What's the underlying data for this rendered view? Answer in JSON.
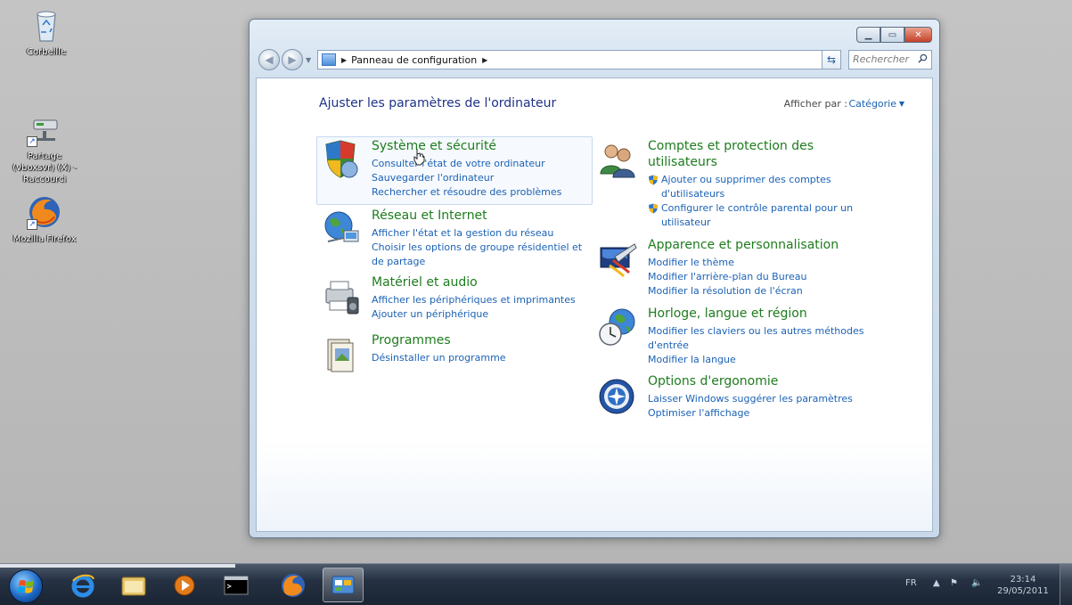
{
  "desktop": {
    "icons": [
      {
        "label": "Corbeille"
      },
      {
        "label": "Partage (vboxsvr) (X) - Raccourci"
      },
      {
        "label": "Mozilla Firefox"
      }
    ]
  },
  "window": {
    "address": {
      "crumb": "Panneau de configuration"
    },
    "search": {
      "placeholder": "Rechercher"
    },
    "page_title": "Ajuster les paramètres de l'ordinateur",
    "view_by": {
      "label": "Afficher par :",
      "value": "Catégorie"
    },
    "left_categories": [
      {
        "title": "Système et sécurité",
        "icon": "shield-security-icon",
        "links": [
          "Consulter l'état de votre ordinateur",
          "Sauvegarder l'ordinateur",
          "Rechercher et résoudre des problèmes"
        ]
      },
      {
        "title": "Réseau et Internet",
        "icon": "network-globe-icon",
        "links": [
          "Afficher l'état et la gestion du réseau",
          "Choisir les options de groupe résidentiel et de partage"
        ]
      },
      {
        "title": "Matériel et audio",
        "icon": "printer-speaker-icon",
        "links": [
          "Afficher les périphériques et imprimantes",
          "Ajouter un périphérique"
        ]
      },
      {
        "title": "Programmes",
        "icon": "programs-box-icon",
        "links": [
          "Désinstaller un programme"
        ]
      }
    ],
    "right_categories": [
      {
        "title": "Comptes et protection des utilisateurs",
        "icon": "users-icon",
        "links": [
          "Ajouter ou supprimer des comptes d'utilisateurs",
          "Configurer le contrôle parental pour un utilisateur"
        ]
      },
      {
        "title": "Apparence et personnalisation",
        "icon": "appearance-icon",
        "links": [
          "Modifier le thème",
          "Modifier l'arrière-plan du Bureau",
          "Modifier la résolution de l'écran"
        ]
      },
      {
        "title": "Horloge, langue et région",
        "icon": "clock-globe-icon",
        "links": [
          "Modifier les claviers ou les autres méthodes d'entrée",
          "Modifier la langue"
        ]
      },
      {
        "title": "Options d'ergonomie",
        "icon": "ease-of-access-icon",
        "links": [
          "Laisser Windows suggérer les paramètres",
          "Optimiser l'affichage"
        ]
      }
    ]
  },
  "taskbar": {
    "language": "FR",
    "clock": {
      "time": "23:14",
      "date": "29/05/2011"
    },
    "colors": {
      "accent": "#1e7c1e",
      "link": "#1b62b5",
      "title": "#1e3287"
    }
  }
}
